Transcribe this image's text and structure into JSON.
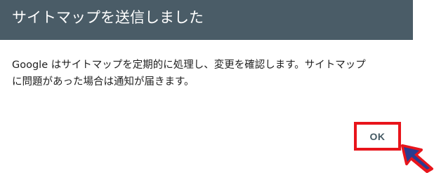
{
  "dialog": {
    "title": "サイトマップを送信しました",
    "message_line1": "Google はサイトマップを定期的に処理し、変更を確認します。サイトマップ",
    "message_line2": "に問題があった場合は通知が届きます。",
    "ok_label": "OK"
  },
  "colors": {
    "header_bg": "#4a5c67",
    "highlight_border": "#e8141b",
    "button_text": "#455a64",
    "arrow_fill": "#2b3b8f",
    "arrow_outline": "#e8141b"
  },
  "icons": {
    "pointer": "arrow-pointer-icon"
  }
}
